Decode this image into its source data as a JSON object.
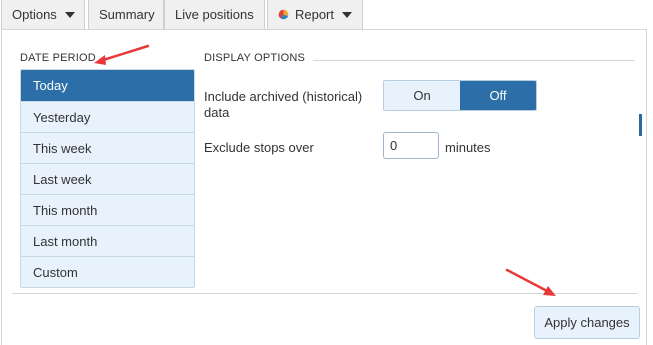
{
  "toolbar": {
    "options_label": "Options",
    "summary_label": "Summary",
    "live_positions_label": "Live positions",
    "report_label": "Report"
  },
  "date_period": {
    "title": "DATE PERIOD",
    "items": [
      {
        "label": "Today",
        "selected": true
      },
      {
        "label": "Yesterday",
        "selected": false
      },
      {
        "label": "This week",
        "selected": false
      },
      {
        "label": "Last week",
        "selected": false
      },
      {
        "label": "This month",
        "selected": false
      },
      {
        "label": "Last month",
        "selected": false
      },
      {
        "label": "Custom",
        "selected": false
      }
    ]
  },
  "display_options": {
    "title": "DISPLAY OPTIONS",
    "include_archived_label": "Include archived (historical) data",
    "toggle_on_label": "On",
    "toggle_off_label": "Off",
    "toggle_selected": "Off",
    "exclude_stops_label": "Exclude stops over",
    "exclude_stops_value": "0",
    "minutes_label": "minutes"
  },
  "apply_button_label": "Apply changes",
  "colors": {
    "accent": "#2b6ea8",
    "light_fill": "#e8f2fc",
    "annotation_arrow": "#e8383a"
  }
}
